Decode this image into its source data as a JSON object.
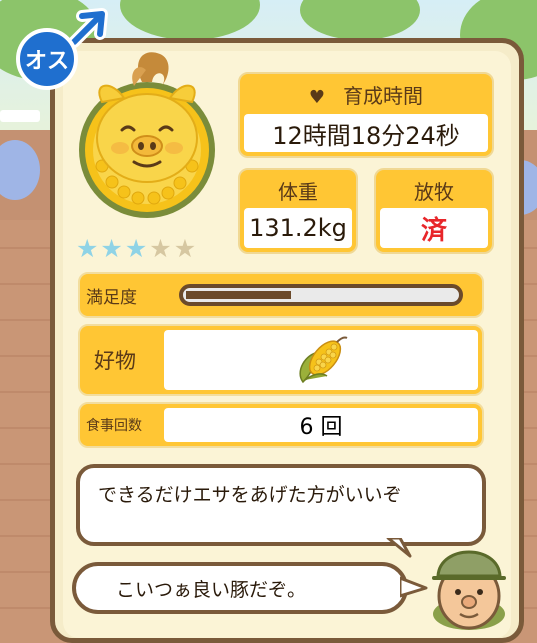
{
  "gender": {
    "label": "オス"
  },
  "stars": {
    "rating": 3,
    "max": 5
  },
  "growth": {
    "label": "育成時間",
    "value": "12時間18分24秒"
  },
  "weight": {
    "label": "体重",
    "value": "131.2kg"
  },
  "release": {
    "label": "放牧",
    "value": "済"
  },
  "satisfaction": {
    "label": "満足度",
    "level": 0.39
  },
  "favorite": {
    "label": "好物",
    "icon": "corn-icon"
  },
  "meals": {
    "label": "食事回数",
    "value": "6 回"
  },
  "dialog": {
    "advice": "できるだけエサをあげた方がいいぞ",
    "comment": "こいつぁ良い豚だぞ。"
  },
  "colors": {
    "accent": "#ffc634",
    "border": "#7a5a3a",
    "release_value": "#e8262a",
    "gender": "#1f6fcf"
  }
}
